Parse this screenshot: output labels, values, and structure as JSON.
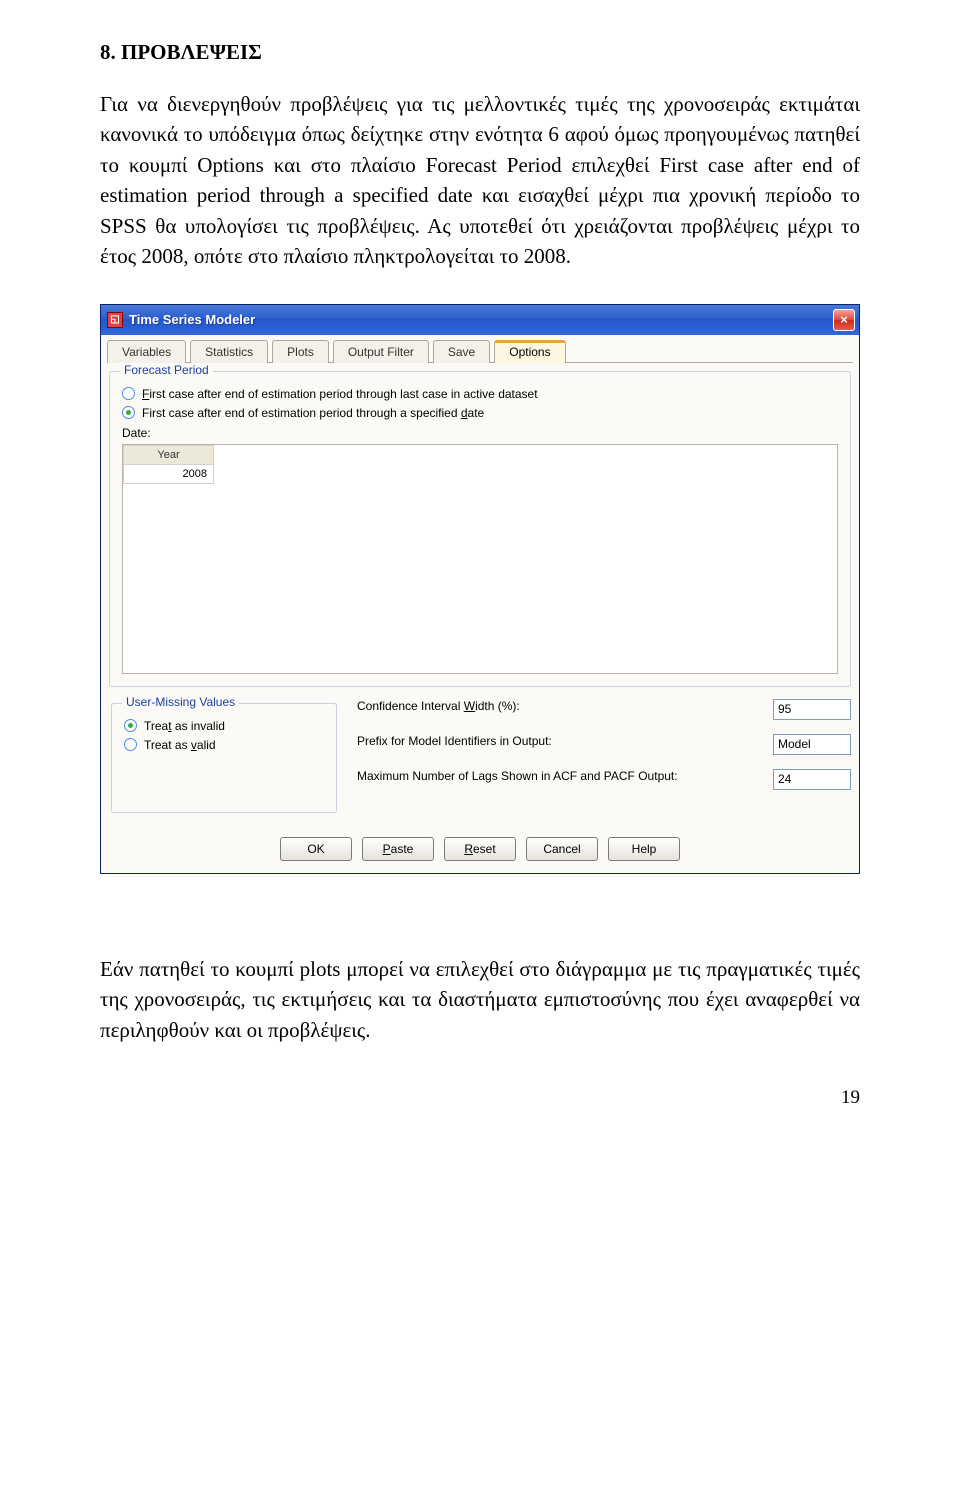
{
  "doc": {
    "heading": "8. ΠΡΟΒΛΕΨΕΙΣ",
    "para1": "Για να διενεργηθούν προβλέψεις για τις μελλοντικές τιμές της χρονοσειράς εκτιμάται κανονικά το υπόδειγμα όπως δείχτηκε στην ενότητα 6 αφού όμως προηγουμένως πατηθεί το κουμπί Options και στο πλαίσιο Forecast Period επιλεχθεί First case after end of estimation period through a specified date και εισαχθεί μέχρι πια χρονική περίοδο το SPSS θα υπολογίσει τις προβλέψεις. Ας υποτεθεί ότι χρειάζονται προβλέψεις μέχρι το έτος 2008, οπότε στο πλαίσιο πληκτρολογείται το 2008.",
    "para2": "Εάν πατηθεί το κουμπί plots μπορεί να επιλεχθεί στο διάγραμμα με τις πραγματικές τιμές της χρονοσειράς, τις εκτιμήσεις και τα διαστήματα εμπιστοσύνης που έχει αναφερθεί να περιληφθούν και οι προβλέψεις.",
    "page_number": "19"
  },
  "window": {
    "title": "Time Series Modeler",
    "close_glyph": "×",
    "tabs": [
      "Variables",
      "Statistics",
      "Plots",
      "Output Filter",
      "Save",
      "Options"
    ],
    "active_tab": 5,
    "forecast_period": {
      "legend": "Forecast Period",
      "opt1": "First case after end of estimation period through last case in active dataset",
      "opt2": "First case after end of estimation period through a specified date",
      "date_label": "Date:",
      "year_header": "Year",
      "year_value": "2008"
    },
    "user_missing": {
      "legend": "User-Missing Values",
      "opt1": "Treat as invalid",
      "opt2": "Treat as valid"
    },
    "settings": {
      "ci_label_pre": "Confidence Interval ",
      "ci_label_key": "W",
      "ci_label_post": "idth (%):",
      "ci_value": "95",
      "prefix_label": "Prefix for Model Identifiers in Output:",
      "prefix_value": "Model",
      "lags_label": "Maximum Number of Lags Shown in ACF and PACF Output:",
      "lags_value": "24"
    },
    "buttons": {
      "ok": "OK",
      "paste_pre": "",
      "paste_key": "P",
      "paste_post": "aste",
      "reset_pre": "",
      "reset_key": "R",
      "reset_post": "eset",
      "cancel": "Cancel",
      "help": "Help"
    }
  }
}
